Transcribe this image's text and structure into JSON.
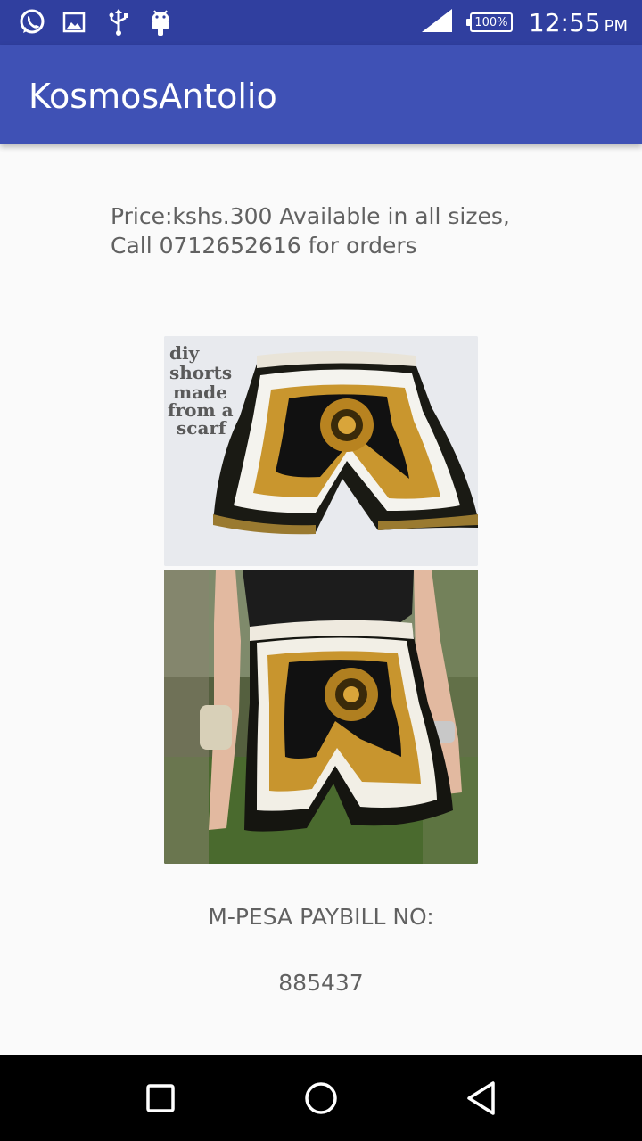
{
  "status_bar": {
    "left_icons": [
      "whatsapp-icon",
      "image-icon",
      "usb-icon",
      "android-icon"
    ],
    "battery": "100%",
    "time": "12:55",
    "ampm": "PM"
  },
  "app_bar": {
    "title": "KosmosAntolio"
  },
  "content": {
    "price_text": "Price:kshs.300 Available in all sizes, Call 0712652616 for orders",
    "image_caption": "diy shorts made from a scarf",
    "paybill_label": "M-PESA PAYBILL NO:",
    "paybill_number": "885437"
  },
  "nav_bar": {
    "buttons": [
      "recent-apps",
      "home",
      "back"
    ]
  },
  "colors": {
    "status_bar": "#303f9f",
    "app_bar": "#3f51b5",
    "background": "#fafafa",
    "text": "#616161"
  }
}
